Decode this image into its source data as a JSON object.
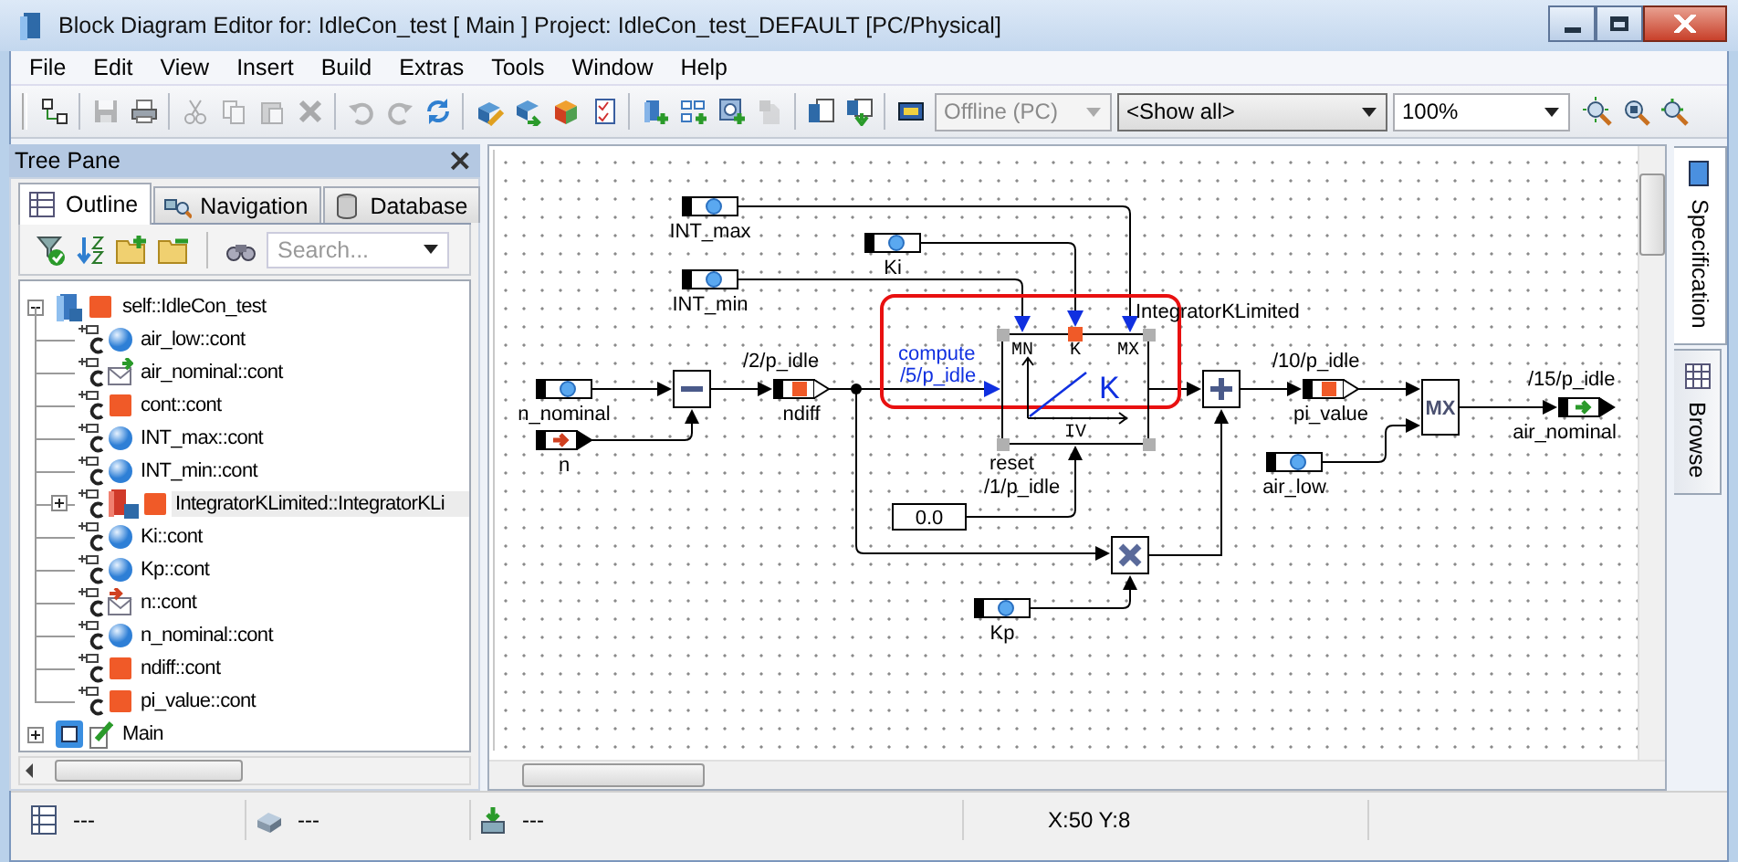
{
  "window": {
    "title": "Block Diagram Editor for: IdleCon_test [ Main ] Project: IdleCon_test_DEFAULT [PC/Physical]"
  },
  "menu": [
    "File",
    "Edit",
    "View",
    "Insert",
    "Build",
    "Extras",
    "Tools",
    "Window",
    "Help"
  ],
  "tool_buttons": [
    {
      "disabled": false
    },
    {
      "disabled": true
    },
    {
      "disabled": false
    },
    {
      "disabled": true
    },
    {
      "disabled": true
    },
    {
      "disabled": true
    },
    {
      "disabled": true
    },
    {
      "disabled": true
    },
    {
      "disabled": true
    },
    {
      "disabled": false
    },
    {
      "disabled": false
    },
    {
      "disabled": false
    },
    {
      "disabled": false
    },
    {
      "disabled": false
    },
    {
      "disabled": false
    },
    {
      "disabled": false
    },
    {
      "disabled": false
    },
    {
      "disabled": true
    },
    {
      "disabled": false
    },
    {
      "disabled": false
    },
    {
      "disabled": false
    },
    {
      "disabled": false
    },
    {
      "disabled": false
    },
    {
      "disabled": false
    }
  ],
  "toolbar": {
    "mode": {
      "value": "Offline (PC)",
      "disabled": true
    },
    "filter": {
      "value": "<Show all>"
    },
    "zoom": {
      "value": "100%"
    }
  },
  "tree_pane": {
    "title": "Tree Pane",
    "tabs": [
      {
        "label": "Outline",
        "selected": true
      },
      {
        "label": "Navigation",
        "selected": false
      },
      {
        "label": "Database",
        "selected": false
      }
    ],
    "search": {
      "placeholder": "Search..."
    },
    "tree": [
      {
        "label": "self::IdleCon_test",
        "kind": "class",
        "expanded": true,
        "children": [
          {
            "label": "air_low::cont",
            "kind": "parameter",
            "selected": false
          },
          {
            "label": "air_nominal::cont",
            "kind": "message-out",
            "selected": false
          },
          {
            "label": "cont::cont",
            "kind": "variable",
            "selected": false
          },
          {
            "label": "INT_max::cont",
            "kind": "parameter",
            "selected": false
          },
          {
            "label": "INT_min::cont",
            "kind": "parameter",
            "selected": false
          },
          {
            "label": "IntegratorKLimited::IntegratorKLi",
            "kind": "block",
            "selected": true,
            "expanded": false
          },
          {
            "label": "Ki::cont",
            "kind": "parameter",
            "selected": false
          },
          {
            "label": "Kp::cont",
            "kind": "parameter",
            "selected": false
          },
          {
            "label": "n::cont",
            "kind": "message-in",
            "selected": false
          },
          {
            "label": "n_nominal::cont",
            "kind": "parameter",
            "selected": false
          },
          {
            "label": "ndiff::cont",
            "kind": "variable",
            "selected": false
          },
          {
            "label": "pi_value::cont",
            "kind": "variable",
            "selected": false
          }
        ]
      },
      {
        "label": "Main",
        "kind": "module",
        "expanded": false
      }
    ]
  },
  "diagram": {
    "ports": [
      {
        "label": "INT_max",
        "kind": "parameter"
      },
      {
        "label": "Ki",
        "kind": "parameter"
      },
      {
        "label": "INT_min",
        "kind": "parameter"
      },
      {
        "label": "n_nominal",
        "kind": "parameter"
      },
      {
        "label": "n",
        "kind": "message-in"
      },
      {
        "label": "ndiff",
        "kind": "variable",
        "rate": "/2/p_idle"
      },
      {
        "label": "pi_value",
        "kind": "variable",
        "rate": "/10/p_idle"
      },
      {
        "label": "air_low",
        "kind": "parameter"
      },
      {
        "label": "air_nominal",
        "kind": "message-out",
        "rate": "/15/p_idle"
      },
      {
        "label": "Kp",
        "kind": "parameter"
      }
    ],
    "operators": [
      {
        "kind": "subtract"
      },
      {
        "kind": "add"
      },
      {
        "kind": "multiply"
      },
      {
        "kind": "max",
        "label": "MX"
      }
    ],
    "constants": [
      {
        "value": "0.0"
      }
    ],
    "block": {
      "name": "IntegratorKLimited",
      "selected": true,
      "symbol": "K",
      "pins": [
        "MN",
        "K",
        "MX",
        "IV"
      ],
      "inputs": [
        {
          "label": "compute",
          "rate": "/5/p_idle"
        },
        {
          "label": "reset",
          "rate": "/1/p_idle"
        }
      ]
    }
  },
  "side_tabs": [
    {
      "label": "Specification",
      "selected": true
    },
    {
      "label": "Browse",
      "selected": false
    }
  ],
  "status_bar": [
    "---",
    "---",
    "---",
    "X:50 Y:8"
  ]
}
